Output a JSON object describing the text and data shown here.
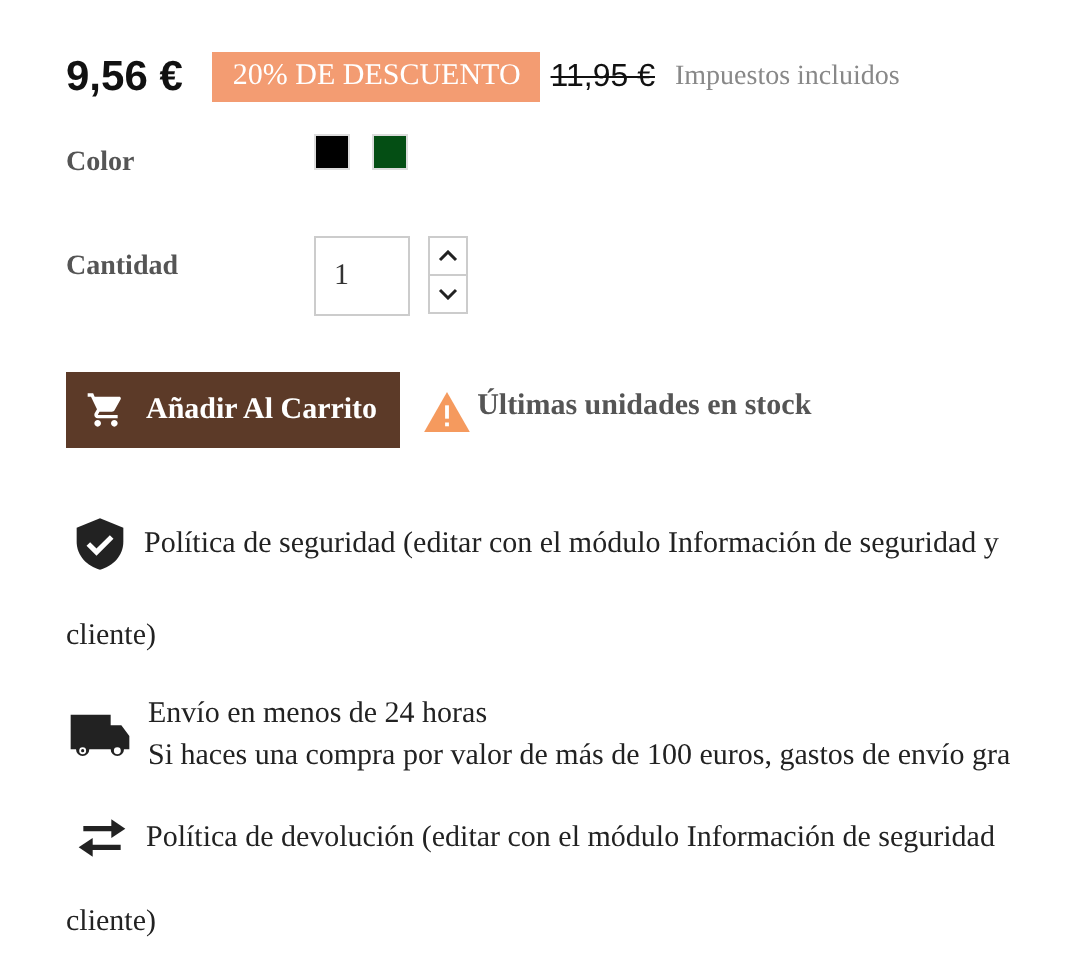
{
  "price": {
    "current": "9,56 €",
    "discount": "20% DE DESCUENTO",
    "regular": "11,95 €",
    "tax_note": "Impuestos incluidos"
  },
  "color": {
    "label": "Color",
    "swatches": [
      {
        "color": "#000000"
      },
      {
        "color": "#044e14"
      }
    ]
  },
  "quantity": {
    "label": "Cantidad",
    "value": "1"
  },
  "add_to_cart": {
    "label": "Añadir Al Carrito"
  },
  "stock_warning": "Últimas unidades en stock",
  "reassurance": [
    {
      "kind": "shield",
      "lines": [
        "Política de seguridad (editar con el módulo Información de seguridad y",
        "cliente)"
      ]
    },
    {
      "kind": "truck",
      "lines": [
        "Envío en menos de 24 horas",
        "Si haces una compra por valor de más de 100 euros, gastos de envío gra"
      ]
    },
    {
      "kind": "arrows",
      "lines": [
        "Política de devolución (editar con el módulo Información de seguridad",
        "cliente)"
      ]
    }
  ]
}
